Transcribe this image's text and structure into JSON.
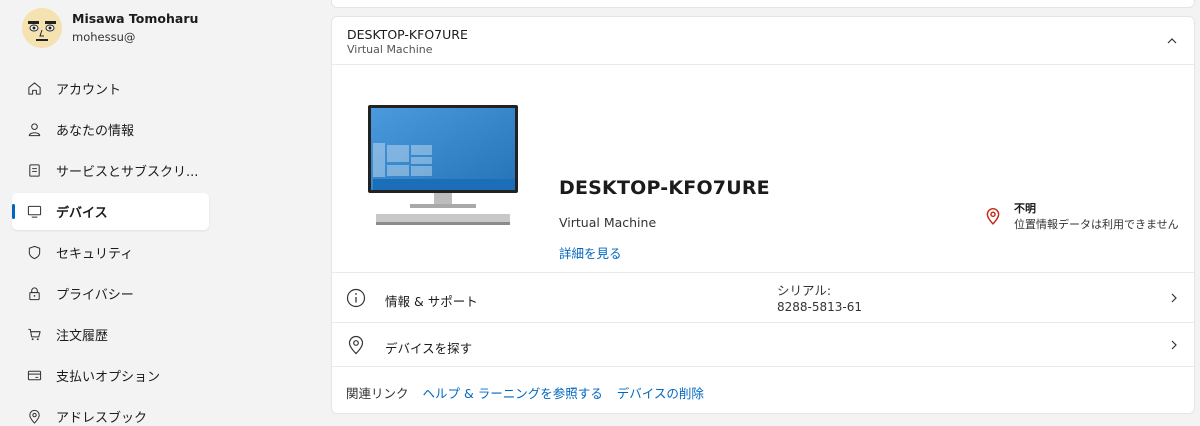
{
  "profile": {
    "name": "Misawa Tomoharu",
    "email": "mohessu@"
  },
  "sidebar": {
    "items": [
      {
        "label": "アカウント",
        "icon": "home-icon"
      },
      {
        "label": "あなたの情報",
        "icon": "person-icon"
      },
      {
        "label": "サービスとサブスクリ...",
        "icon": "document-icon"
      },
      {
        "label": "デバイス",
        "icon": "monitor-icon",
        "active": true
      },
      {
        "label": "セキュリティ",
        "icon": "shield-icon"
      },
      {
        "label": "プライバシー",
        "icon": "lock-icon"
      },
      {
        "label": "注文履歴",
        "icon": "cart-icon"
      },
      {
        "label": "支払いオプション",
        "icon": "credit-card-icon"
      },
      {
        "label": "アドレスブック",
        "icon": "location-icon"
      }
    ]
  },
  "device_card": {
    "header_title": "DESKTOP-KFO7URE",
    "header_subtitle": "Virtual Machine",
    "device_name": "DESKTOP-KFO7URE",
    "device_type": "Virtual Machine",
    "details_link": "詳細を見る",
    "location_title": "不明",
    "location_desc": "位置情報データは利用できません",
    "info_label": "情報 & サポート",
    "serial_label": "シリアル:",
    "serial_value": "8288-5813-61",
    "find_label": "デバイスを探す",
    "related_label": "関連リンク",
    "related_links": [
      "ヘルプ & ラーニングを参照する",
      "デバイスの削除"
    ]
  },
  "colors": {
    "accent": "#0067c0",
    "location_pin": "#c42b1c",
    "monitor_screen": "#2b88d8"
  }
}
